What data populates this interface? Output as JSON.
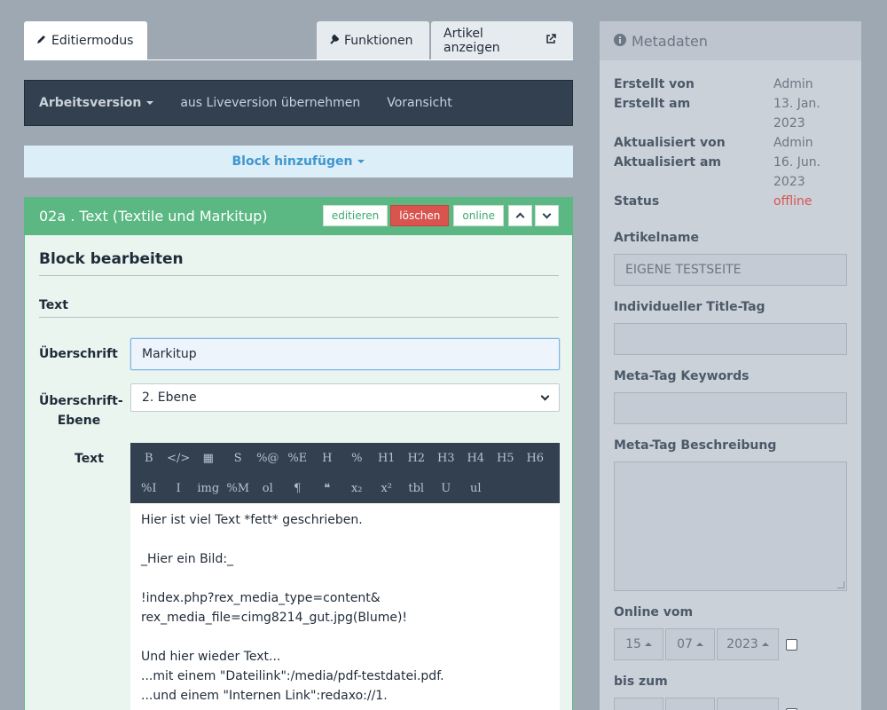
{
  "tabs": {
    "edit": "Editiermodus",
    "functions": "Funktionen",
    "view_article": "Artikel anzeigen"
  },
  "nav": {
    "version": "Arbeitsversion",
    "take_live": "aus Liveversion übernehmen",
    "preview": "Voransicht"
  },
  "add_block": "Block hinzufügen",
  "block": {
    "title": "02a . Text (Textile und Markitup)",
    "actions": {
      "edit": "editieren",
      "delete": "löschen",
      "status": "online"
    },
    "edit_heading": "Block bearbeiten",
    "section": "Text",
    "heading_label": "Überschrift",
    "heading_value": "Markitup",
    "level_label_1": "Überschrift-",
    "level_label_2": "Ebene",
    "level_value": "2. Ebene",
    "text_label": "Text",
    "toolbar_row1": [
      "B",
      "</>",
      "▦",
      "S",
      "%@",
      "%E",
      "H",
      "%",
      "H1",
      "H2",
      "H3",
      "H4",
      "H5",
      "H6"
    ],
    "toolbar_row2": [
      "%I",
      "I",
      "img",
      "%M",
      "ol",
      "¶",
      "❝",
      "x₂",
      "x²",
      "tbl",
      "U",
      "ul"
    ],
    "text_lines": [
      "Hier ist viel Text *fett* geschrieben.",
      "",
      "_Hier ein Bild:_",
      "",
      "!index.php?rex_media_type=content&",
      "rex_media_file=cimg8214_gut.jpg(Blume)!",
      "",
      "Und hier wieder Text...",
      "...mit einem \"Dateilink\":/media/pdf-testdatei.pdf.",
      "...und einem \"Internen Link\":redaxo://1."
    ]
  },
  "sidebar": {
    "title": "Metadaten",
    "meta": {
      "created_by_label": "Erstellt von",
      "created_by": "Admin",
      "created_at_label": "Erstellt am",
      "created_at_1": "13. Jan.",
      "created_at_2": "2023",
      "updated_by_label": "Aktualisiert von",
      "updated_by": "Admin",
      "updated_at_label": "Aktualisiert am",
      "updated_at_1": "16. Jun.",
      "updated_at_2": "2023",
      "status_label": "Status",
      "status": "offline"
    },
    "article_name_label": "Artikelname",
    "article_name": "EIGENE TESTSEITE",
    "title_tag_label": "Individueller Title-Tag",
    "keywords_label": "Meta-Tag Keywords",
    "description_label": "Meta-Tag Beschreibung",
    "online_from_label": "Online vom",
    "online_from": {
      "day": "15",
      "month": "07",
      "year": "2023"
    },
    "until_label": "bis zum"
  },
  "colors": {
    "accent_green": "#5bb883",
    "danger": "#d9534f",
    "nav_dark": "#324050",
    "link_blue": "#3e97d0"
  }
}
